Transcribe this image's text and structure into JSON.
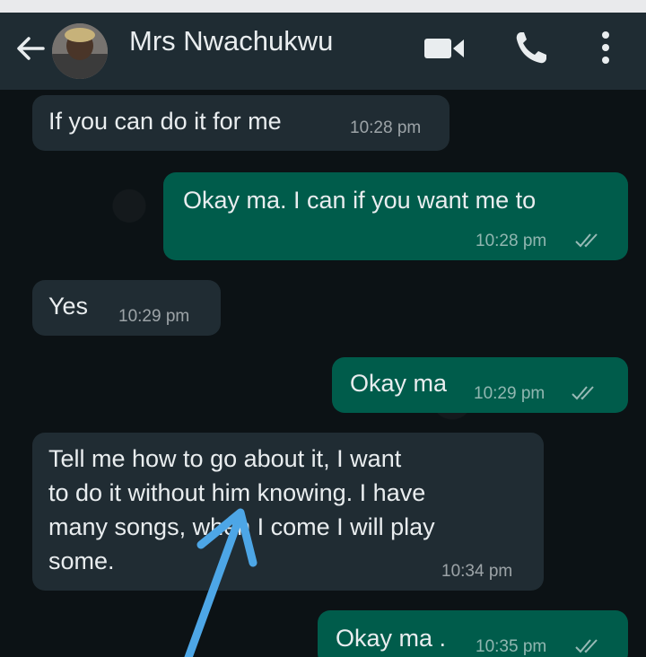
{
  "header": {
    "contact_name": "Mrs Nwachukwu",
    "icons": [
      "back-arrow-icon",
      "avatar",
      "video-call-icon",
      "voice-call-icon",
      "more-options-icon"
    ]
  },
  "messages": [
    {
      "direction": "incoming",
      "text": "If you can do it for me",
      "time": "10:28 pm"
    },
    {
      "direction": "outgoing",
      "text": "Okay ma. I can if you want me to",
      "time": "10:28 pm"
    },
    {
      "direction": "incoming",
      "text": "Yes",
      "time": "10:29 pm"
    },
    {
      "direction": "outgoing",
      "text": "Okay ma",
      "time": "10:29 pm"
    },
    {
      "direction": "incoming",
      "lines": [
        "Tell me how to go about it, I want",
        "to do it without him knowing. I have",
        "many songs, when I come I will play",
        "some."
      ],
      "time": "10:34 pm"
    },
    {
      "direction": "outgoing",
      "text": "Okay ma .",
      "time": "10:35 pm"
    }
  ],
  "colors": {
    "chat_background": "#0c1215",
    "header_background": "#1f2c33",
    "incoming_bubble": "#202c33",
    "outgoing_bubble": "#005c4b",
    "annotation_arrow": "#4da6e6"
  }
}
